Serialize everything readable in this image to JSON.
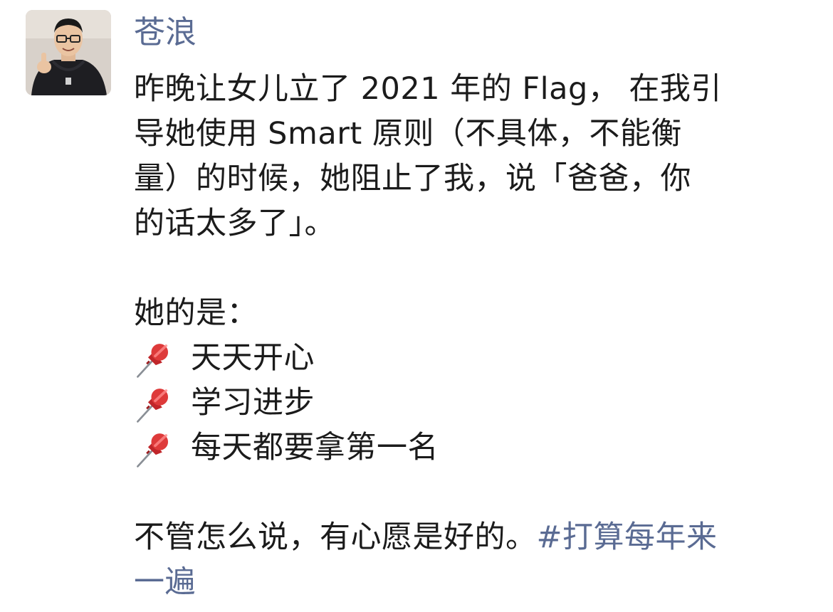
{
  "post": {
    "author": "苍浪",
    "paragraph1": [
      "昨晚让女儿立了 2021 年的 Flag， 在我引",
      "导她使用 Smart 原则（不具体，不能衡",
      "量）的时候，她阻止了我，说「爸爸，你",
      "的话太多了」。"
    ],
    "list_intro": "她的是：",
    "list_items": [
      {
        "icon": "pushpin-icon",
        "text": "天天开心"
      },
      {
        "icon": "pushpin-icon",
        "text": "学习进步"
      },
      {
        "icon": "pushpin-icon",
        "text": "每天都要拿第一名"
      }
    ],
    "closing_text": "不管怎么说，有心愿是好的。",
    "hashtag_part1": "#打算每年来",
    "hashtag_part2": "一遍"
  },
  "colors": {
    "author_name": "#5a6b93",
    "hashtag": "#5a6b93",
    "body_text": "#1b1b1b"
  }
}
